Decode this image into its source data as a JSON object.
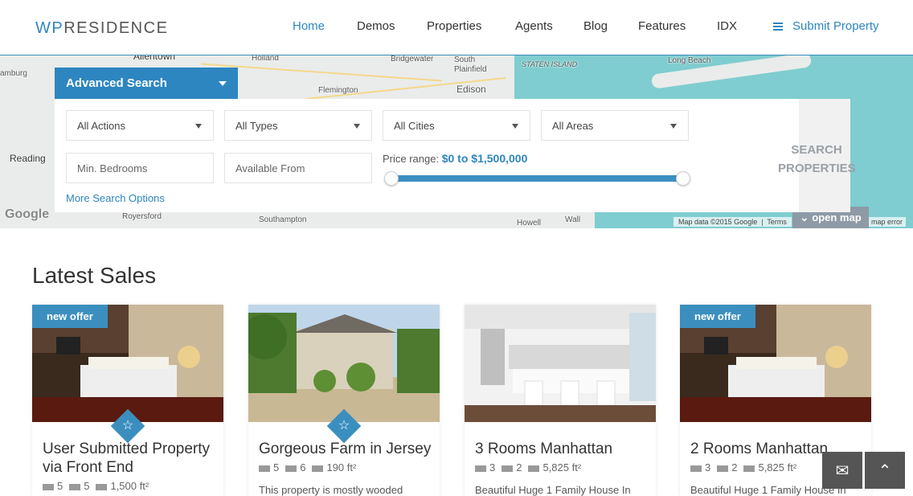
{
  "header": {
    "logo_wp": "WP",
    "logo_rest": "RESIDENCE",
    "nav": [
      "Home",
      "Demos",
      "Properties",
      "Agents",
      "Blog",
      "Features",
      "IDX"
    ],
    "submit": "Submit Property"
  },
  "map": {
    "labels": [
      "Allentown",
      "Holland",
      "Bridgewater",
      "South Plainfield",
      "STATEN ISLAND",
      "Long Beach",
      "amburg",
      "Flemington",
      "Edison",
      "Reading",
      "Royersford",
      "Southampton",
      "Howell",
      "Wall"
    ],
    "google": "Google",
    "map_data": "Map data ©2015 Google",
    "terms": "Terms",
    "error": "map error",
    "open_map": "open map"
  },
  "search": {
    "tab": "Advanced Search",
    "actions": "All Actions",
    "types": "All Types",
    "cities": "All Cities",
    "areas": "All Areas",
    "bedrooms_placeholder": "Min. Bedrooms",
    "available_placeholder": "Available From",
    "price_label": "Price range:",
    "price_value": "$0 to $1,500,000",
    "more": "More Search Options",
    "button_line1": "SEARCH",
    "button_line2": "PROPERTIES"
  },
  "latest": {
    "title": "Latest Sales",
    "cards": [
      {
        "badge": "new offer",
        "title": "User Submitted Property via Front End",
        "beds": "5",
        "baths": "5",
        "area": "1,500 ft²",
        "desc": ""
      },
      {
        "badge": "",
        "title": "Gorgeous Farm in Jersey",
        "beds": "5",
        "baths": "6",
        "area": "190 ft²",
        "desc": "This property is mostly wooded"
      },
      {
        "badge": "",
        "title": "3 Rooms Manhattan",
        "beds": "3",
        "baths": "2",
        "area": "5,825 ft²",
        "desc": "Beautiful Huge 1 Family House In"
      },
      {
        "badge": "new offer",
        "title": "2 Rooms Manhattan",
        "beds": "3",
        "baths": "2",
        "area": "5,825 ft²",
        "desc": "Beautiful Huge 1 Family House In"
      }
    ]
  },
  "colors": {
    "accent": "#2d86c0",
    "water": "#7fcdd0"
  }
}
